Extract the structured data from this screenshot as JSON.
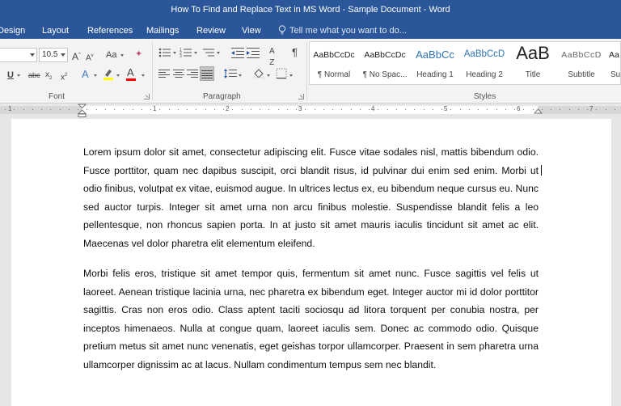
{
  "window": {
    "title": "How To Find and Replace Text in MS Word - Sample Document - Word"
  },
  "tabs": [
    "Design",
    "Layout",
    "References",
    "Mailings",
    "Review",
    "View"
  ],
  "tell_me": "Tell me what you want to do...",
  "font": {
    "size": "10.5",
    "group_label": "Font"
  },
  "paragraph": {
    "group_label": "Paragraph"
  },
  "styles": {
    "group_label": "Styles",
    "items": [
      {
        "preview": "AaBbCcDc",
        "name": "¶ Normal"
      },
      {
        "preview": "AaBbCcDc",
        "name": "¶ No Spac..."
      },
      {
        "preview": "AaBbCc",
        "name": "Heading 1"
      },
      {
        "preview": "AaBbCcD",
        "name": "Heading 2"
      },
      {
        "preview": "AaB",
        "name": "Title"
      },
      {
        "preview": "AaBbCcD",
        "name": "Subtitle"
      },
      {
        "preview": "Aa",
        "name": "Sub"
      }
    ]
  },
  "ruler": {
    "labels": [
      "1",
      "1",
      "2",
      "3",
      "4",
      "5",
      "6",
      "7"
    ]
  },
  "document": {
    "paragraphs": [
      "Lorem ipsum dolor sit amet, consectetur adipiscing elit. Fusce vitae sodales nisl, mattis bibendum odio. Fusce porttitor, quam nec dapibus suscipit, orci blandit risus, id pulvinar dui enim sed enim. Morbi ut odio finibus, volutpat ex vitae, euismod augue. In ultrices lectus ex, eu bibendum neque cursus eu. Nunc sed auctor turpis. Integer sit amet urna non arcu finibus molestie. Suspendisse blandit felis a leo pellentesque, non rhoncus sapien porta. In at justo sit amet mauris iaculis tincidunt sit amet ac elit. Maecenas vel dolor pharetra elit elementum eleifend.",
      "Morbi felis eros, tristique sit amet tempor quis, fermentum sit amet nunc. Fusce sagittis vel felis ut laoreet. Aenean tristique lacinia urna, nec pharetra ex bibendum eget. Integer auctor mi id dolor porttitor sagittis. Cras non eros odio. Class aptent taciti sociosqu ad litora torquent per conubia nostra, per inceptos himenaeos. Nulla at congue quam, laoreet iaculis sem. Donec ac commodo odio. Quisque pretium metus sit amet nunc venenatis, eget geishas torpor ullamcorper. Praesent in sem pharetra urna ullamcorper dignissim ac at lacus. Nullam condimentum tempus sem nec blandit."
    ]
  },
  "colors": {
    "titlebar": "#2b579a",
    "highlight": "#ffff00",
    "font_color": "#ff0000"
  }
}
